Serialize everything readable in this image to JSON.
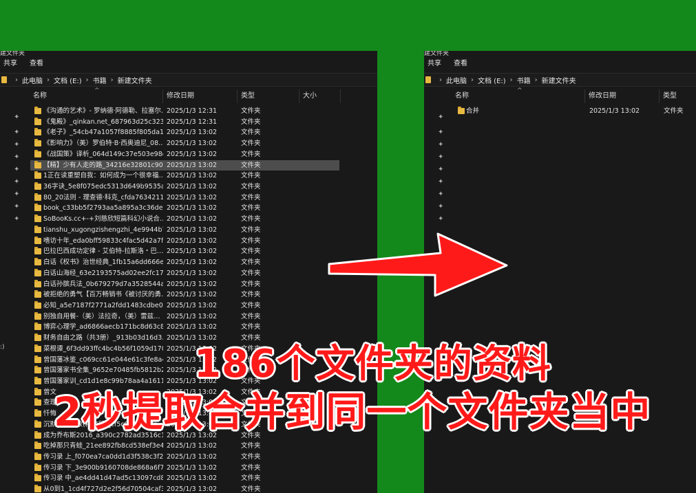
{
  "left_window": {
    "title": "建文件夹",
    "menu": [
      "共享",
      "查看"
    ],
    "breadcrumb": [
      "此电脑",
      "文档 (E:)",
      "书籍",
      "新建文件夹"
    ],
    "columns": {
      "name": "名称",
      "date": "修改日期",
      "type": "类型",
      "size": "大小"
    },
    "rows": [
      {
        "name": "《沟通的艺术》- 罗纳德·阿德勒、拉塞尔…",
        "date": "2025/1/3 12:31",
        "type": "文件夹"
      },
      {
        "name": "《鬼殿》_qinkan.net_687963d25c323f…",
        "date": "2025/1/3 12:31",
        "type": "文件夹"
      },
      {
        "name": "《老子》_54cb47a1057f8885f805da16…",
        "date": "2025/1/3 13:02",
        "type": "文件夹"
      },
      {
        "name": "《影响力》（美）罗伯特·B·西奥迪尼_08…",
        "date": "2025/1/3 13:02",
        "type": "文件夹"
      },
      {
        "name": "《战国策》译析_064d149c37e503e98d…",
        "date": "2025/1/3 13:02",
        "type": "文件夹"
      },
      {
        "name": "【精】少有人走的路_34216e32801c90c…",
        "date": "2025/1/3 13:02",
        "type": "文件夹",
        "selected": true
      },
      {
        "name": "1正在读重塑自我：如何成为一个很幸福…",
        "date": "2025/1/3 13:02",
        "type": "文件夹"
      },
      {
        "name": "36字诀_5e8f075edc5313d649b9535a6…",
        "date": "2025/1/3 13:02",
        "type": "文件夹"
      },
      {
        "name": "80_20法则 - 理查德·科克_cfda7634211…",
        "date": "2025/1/3 13:02",
        "type": "文件夹"
      },
      {
        "name": "book_c33bb5f2793aa5a895a3c36dea…",
        "date": "2025/1/3 13:02",
        "type": "文件夹"
      },
      {
        "name": "SoBooKs.cc+-+刘慈欣短篇科幻小说合…",
        "date": "2025/1/3 13:02",
        "type": "文件夹"
      },
      {
        "name": "tianshu_xugongzishengzhi_4e9944b7…",
        "date": "2025/1/3 13:02",
        "type": "文件夹"
      },
      {
        "name": "嗜访十年_eda0bff59833c4fac5d42a7f3…",
        "date": "2025/1/3 13:02",
        "type": "文件夹"
      },
      {
        "name": "巴拉巴西成功定律 - 艾伯特-拉斯洛・巴…",
        "date": "2025/1/3 13:02",
        "type": "文件夹"
      },
      {
        "name": "白话《权书》治世经典_1fb15a6dd666e…",
        "date": "2025/1/3 13:02",
        "type": "文件夹"
      },
      {
        "name": "白话山海经_63e2193575ad02ee2fc174…",
        "date": "2025/1/3 13:02",
        "type": "文件夹"
      },
      {
        "name": "白话孙膑兵法_0b679279d7a3528544a…",
        "date": "2025/1/3 13:02",
        "type": "文件夹"
      },
      {
        "name": "被拒绝的勇气【百万畅销书《被讨厌的勇…",
        "date": "2025/1/3 13:02",
        "type": "文件夹"
      },
      {
        "name": "必知_a5e7187f2771a2fdd1483cdbe09…",
        "date": "2025/1/3 13:02",
        "type": "文件夹"
      },
      {
        "name": "别独自用餐-（美）法拉奇，（美）雷兹…",
        "date": "2025/1/3 13:02",
        "type": "文件夹"
      },
      {
        "name": "博弈心理学_ad6866aecb171bc8d63c8…",
        "date": "2025/1/3 13:02",
        "type": "文件夹"
      },
      {
        "name": "财务自由之路（共3册）_913b03d16d3…",
        "date": "2025/1/3 13:02",
        "type": "文件夹"
      },
      {
        "name": "菜根谭_6f3dd93ffc4bc4b56f1059d170…",
        "date": "2025/1/3 13:02",
        "type": "文件夹"
      },
      {
        "name": "曾国藩冰鉴_c069cc61e044e61c3fe8a4…",
        "date": "2025/1/3 13:02",
        "type": "文件夹"
      },
      {
        "name": "曾国藩家书全集_9652e70485fb5812b2…",
        "date": "2025/1/3 13:02",
        "type": "文件夹"
      },
      {
        "name": "曾国藩家训_cd1d1e8c99b78aa4a1611…",
        "date": "2025/1/3 13:02",
        "type": "文件夹"
      },
      {
        "name": "曾文",
        "date": "2025/1/3 13:02",
        "type": "文件夹"
      },
      {
        "name": "查理",
        "date": "2025/1/3 13:02",
        "type": "文件夹"
      },
      {
        "name": "忏悔",
        "date": "2025/1/3 13:02",
        "type": "文件夹"
      },
      {
        "name": "沉默的大多数(精校版)_cf5c07e…d6fa…",
        "date": "2025/1/3 13:02",
        "type": "文件夹"
      },
      {
        "name": "成为乔布斯2016_a390c2782ad3516c1…",
        "date": "2025/1/3 13:02",
        "type": "文件夹"
      },
      {
        "name": "吃掉那只青蛙_21ee892fb8cd538ef3e4…",
        "date": "2025/1/3 13:02",
        "type": "文件夹"
      },
      {
        "name": "传习录 上_f070ea7ca0dd1d3f538c3f22…",
        "date": "2025/1/3 13:02",
        "type": "文件夹"
      },
      {
        "name": "传习录 下_3e900b9160708de868a6f72…",
        "date": "2025/1/3 13:02",
        "type": "文件夹"
      },
      {
        "name": "传习录 中_ae4dd41d47ad5c13097cd8…",
        "date": "2025/1/3 13:02",
        "type": "文件夹"
      },
      {
        "name": "从0到1_1cd4f727d2e2f56d70504caf30…",
        "date": "2025/1/3 13:02",
        "type": "文件夹"
      }
    ],
    "sidebar_text": ":)"
  },
  "right_window": {
    "title": "建文件夹",
    "menu": [
      "共享",
      "查看"
    ],
    "breadcrumb": [
      "此电脑",
      "文档 (E:)",
      "书籍",
      "新建文件夹"
    ],
    "columns": {
      "name": "名称",
      "date": "修改日期",
      "type": "类型"
    },
    "rows": [
      {
        "name": "合并",
        "date": "2025/1/3 13:02",
        "type": "文件夹"
      }
    ]
  },
  "overlay": {
    "line1": "186个文件夹的资料",
    "line2": "2秒提取合并到同一个文件夹当中",
    "text_color": "#ff1a1a",
    "arrow_color": "#ff1a1a",
    "background_color": "#13891b"
  },
  "icons": {
    "folder": "folder-icon",
    "pin": "pin-icon",
    "separator": "chevron-right-icon",
    "arrow": "arrow-right-icon"
  }
}
